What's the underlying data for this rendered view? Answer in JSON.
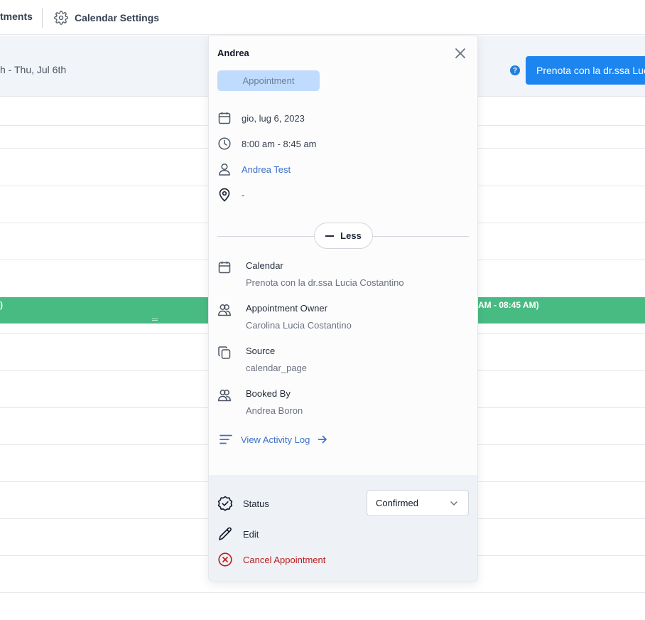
{
  "topnav": {
    "appointments_label": "tments",
    "settings_label": "Calendar Settings"
  },
  "header": {
    "date_range": "h - Thu, Jul 6th",
    "book_button": "Prenota con la dr.ssa Luc"
  },
  "event": {
    "left_text": ")",
    "right_text": "AM - 08:45 AM)"
  },
  "popover": {
    "title": "Andrea",
    "type_badge": "Appointment",
    "date": "gio, lug 6, 2023",
    "time": "8:00 am - 8:45 am",
    "contact": "Andrea Test",
    "location": "-",
    "less_button": "Less",
    "details": [
      {
        "label": "Calendar",
        "value": "Prenota con la dr.ssa Lucia Costantino"
      },
      {
        "label": "Appointment Owner",
        "value": "Carolina Lucia Costantino"
      },
      {
        "label": "Source",
        "value": "calendar_page"
      },
      {
        "label": "Booked By",
        "value": "Andrea Boron"
      }
    ],
    "activity_log": "View Activity Log",
    "status_label": "Status",
    "status_value": "Confirmed",
    "edit_label": "Edit",
    "cancel_label": "Cancel Appointment"
  },
  "colors": {
    "primary": "#1d85f0",
    "event_green": "#48bb83",
    "link": "#3b6fc9",
    "danger": "#b91c1c",
    "badge_bg": "#bfdbfe"
  }
}
